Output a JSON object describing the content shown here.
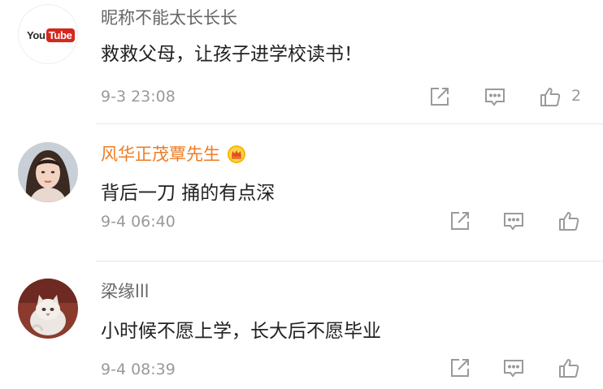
{
  "comments": [
    {
      "avatar": {
        "type": "youtube-logo",
        "you": "You",
        "tube": "Tube"
      },
      "username": "昵称不能太长长长",
      "content": "救救父母，让孩子进学校读书！",
      "time": "9-3 23:08",
      "like_count": "2"
    },
    {
      "avatar": {
        "type": "photo-woman"
      },
      "username": "风华正茂覃先生",
      "username_color": "#ef7b23",
      "badge": "vip-crown-icon",
      "content": "背后一刀 捅的有点深",
      "time": "9-4 06:40"
    },
    {
      "avatar": {
        "type": "photo-cat"
      },
      "username": "梁缘lll",
      "content": "小时候不愿上学，长大后不愿毕业",
      "time": "9-4 08:39"
    }
  ],
  "colors": {
    "text": "#222222",
    "meta": "#9a9a9a",
    "icon": "#9a9a9a",
    "vip_name": "#ef7b23",
    "youtube_red": "#d4281f"
  }
}
